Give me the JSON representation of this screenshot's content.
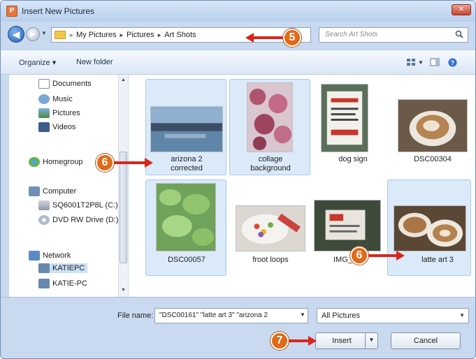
{
  "window": {
    "title": "Insert New Pictures",
    "close_glyph": "✕"
  },
  "nav": {
    "breadcrumb": [
      "My Pictures",
      "Pictures",
      "Art Shots"
    ],
    "search_placeholder": "Search Art Shots"
  },
  "toolbar": {
    "organize_label": "Organize ▾",
    "new_folder_label": "New folder"
  },
  "sidebar": {
    "items": [
      {
        "label": "Documents",
        "icon": "documents-icon"
      },
      {
        "label": "Music",
        "icon": "music-icon"
      },
      {
        "label": "Pictures",
        "icon": "pictures-icon"
      },
      {
        "label": "Videos",
        "icon": "videos-icon"
      },
      {
        "label": "Homegroup",
        "icon": "homegroup-icon"
      },
      {
        "label": "Computer",
        "icon": "computer-icon"
      },
      {
        "label": "SQ6001T2P8L (C:)",
        "icon": "drive-icon"
      },
      {
        "label": "DVD RW Drive (D:)",
        "icon": "dvd-drive-icon"
      },
      {
        "label": "Network",
        "icon": "network-icon"
      },
      {
        "label": "KATIEPC",
        "icon": "network-pc-icon"
      },
      {
        "label": "KATIE-PC",
        "icon": "network-pc-icon"
      }
    ]
  },
  "files": [
    {
      "name": "arizona 2 corrected",
      "line1": "arizona 2",
      "line2": "corrected",
      "selected": true
    },
    {
      "name": "collage background",
      "line1": "collage",
      "line2": "background",
      "selected": true
    },
    {
      "name": "dog sign",
      "line1": "dog sign",
      "line2": "",
      "selected": false
    },
    {
      "name": "DSC00304",
      "line1": "DSC00304",
      "line2": "",
      "selected": false
    },
    {
      "name": "DSC00057",
      "line1": "DSC00057",
      "line2": "",
      "selected": true
    },
    {
      "name": "froot loops",
      "line1": "froot loops",
      "line2": "",
      "selected": false
    },
    {
      "name": "IMG_",
      "line1": "IMG_",
      "line2": "",
      "selected": false
    },
    {
      "name": "latte art 3",
      "line1": "latte art 3",
      "line2": "",
      "selected": true
    }
  ],
  "footer": {
    "file_name_label": "File name:",
    "file_name_value": "\"DSC00161\" \"latte art 3\" \"arizona 2",
    "file_type_value": "All Pictures",
    "insert_label": "Insert",
    "cancel_label": "Cancel"
  },
  "callouts": {
    "step5": "5",
    "step6": "6",
    "step7": "7"
  }
}
